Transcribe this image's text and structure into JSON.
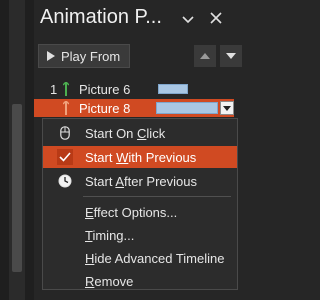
{
  "pane": {
    "title": "Animation P...",
    "play_from_label": "Play From"
  },
  "animations": [
    {
      "number": "1",
      "name": "Picture 6",
      "selected": false
    },
    {
      "number": "",
      "name": "Picture 8",
      "selected": true
    }
  ],
  "context_menu": {
    "items": [
      {
        "pre": "Start On ",
        "key": "C",
        "post": "lick",
        "icon": "mouse-icon",
        "selected": false
      },
      {
        "pre": "Start ",
        "key": "W",
        "post": "ith Previous",
        "icon": "checkmark-icon",
        "selected": true
      },
      {
        "pre": "Start ",
        "key": "A",
        "post": "fter Previous",
        "icon": "clock-icon",
        "selected": false
      },
      {
        "pre": "",
        "key": "E",
        "post": "ffect Options...",
        "icon": "",
        "selected": false
      },
      {
        "pre": "",
        "key": "T",
        "post": "iming...",
        "icon": "",
        "selected": false
      },
      {
        "pre": "",
        "key": "H",
        "post": "ide Advanced Timeline",
        "icon": "",
        "selected": false
      },
      {
        "pre": "",
        "key": "R",
        "post": "emove",
        "icon": "",
        "selected": false
      }
    ]
  },
  "colors": {
    "accent": "#d04a22",
    "timing_bar": "#a9c7e4",
    "panel_bg": "#262626"
  }
}
